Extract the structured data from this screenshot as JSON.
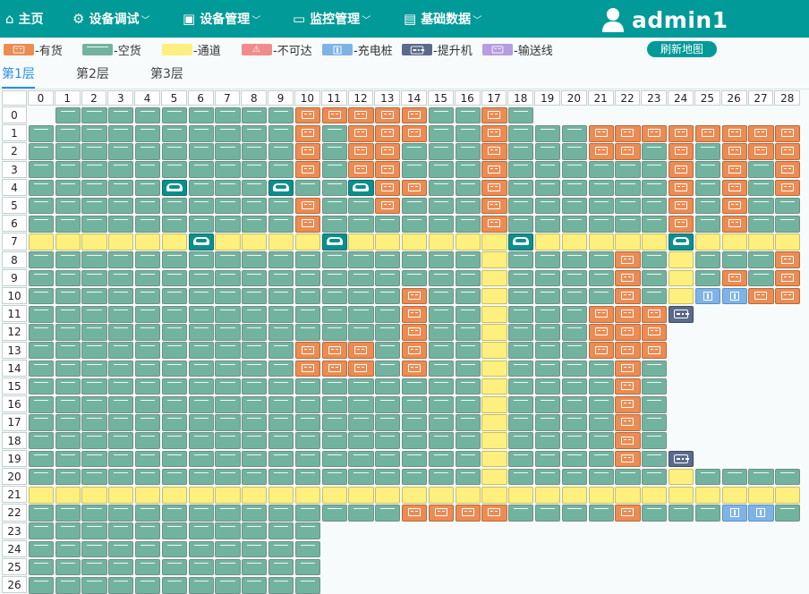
{
  "nav": {
    "items": [
      {
        "label": "主页",
        "icon": "home-icon",
        "dropdown": false
      },
      {
        "label": "设备调试",
        "icon": "gear-icon",
        "dropdown": true
      },
      {
        "label": "设备管理",
        "icon": "chip-icon",
        "dropdown": true
      },
      {
        "label": "监控管理",
        "icon": "camera-icon",
        "dropdown": true
      },
      {
        "label": "基础数据",
        "icon": "clipboard-icon",
        "dropdown": true
      }
    ],
    "user": {
      "name": "admin1",
      "icon": "user-icon"
    }
  },
  "legend": [
    {
      "key": "goods",
      "label": "-有货",
      "color": "#ec8b52"
    },
    {
      "key": "empty",
      "label": "-空货",
      "color": "#72b39f"
    },
    {
      "key": "aisle",
      "label": "-通道",
      "color": "#fdf07e"
    },
    {
      "key": "blocked",
      "label": "-不可达",
      "color": "#f28c8c"
    },
    {
      "key": "charge",
      "label": "-充电桩",
      "color": "#7fb3e6"
    },
    {
      "key": "lift",
      "label": "-提升机",
      "color": "#5b6a8a"
    },
    {
      "key": "conveyor",
      "label": "-输送线",
      "color": "#b69ce0"
    }
  ],
  "refresh_label": "刷新地图",
  "floor_tabs": [
    {
      "label": "第1层",
      "active": true
    },
    {
      "label": "第2层",
      "active": false
    },
    {
      "label": "第3层",
      "active": false
    }
  ],
  "grid": {
    "columns": [
      "0",
      "1",
      "2",
      "3",
      "4",
      "5",
      "6",
      "7",
      "8",
      "9",
      "10",
      "11",
      "12",
      "13",
      "14",
      "15",
      "16",
      "17",
      "18",
      "19",
      "20",
      "21",
      "22",
      "23",
      "24",
      "25",
      "26",
      "27",
      "28"
    ],
    "rows": [
      "0",
      "1",
      "2",
      "3",
      "4",
      "5",
      "6",
      "7",
      "8",
      "9",
      "10",
      "11",
      "12",
      "13",
      "14",
      "15",
      "16",
      "17",
      "18",
      "19",
      "20",
      "21",
      "22",
      "23",
      "24",
      "25",
      "26"
    ],
    "codes": {
      ".": "none",
      "E": "empty",
      "G": "goods",
      "Y": "aisle",
      "R": "robot",
      "C": "charge",
      "L": "lift"
    },
    "map": [
      ".EEEEEEEEEGGGGGEEGE..........",
      "EEEEEEEEEEGEGGGEEGEEEGGGGGGGG",
      "EEEEEEEEEEGEGGEEEGEEEGGEGEGGG",
      "EEEEEEEEEEGEGGEEEGEEEEEEGEGEG",
      "EEEEEREEEREERGGEEGEEEEEEGEGEG",
      "EEEEEEEEEEGEEGEEEGEEEEEEGEGEE",
      "EEEEEEEEEEGEEEEEEGEEEEEEGEGEE",
      "YYYYYYRYYYYRYYYYYYRYYYYYRYYYY",
      "EEEEEEEEEEEEEEEEEYEEEEGEYEEEG",
      "EEEEEEEEEEEEEEEEEYEEEEGEYEGEG",
      "EEEEEEEEEEEEEEGEEYEEEEGEYCCGG",
      "EEEEEEEEEEEEEEGEEYEEEGGGL....",
      "EEEEEEEEEEEEEEGEEYEEEGGG.....",
      "EEEEEEEEEEGGGEGEEYEEEGGG.....",
      "EEEEEEEEEEGGGEGEEYEEEEGE.....",
      "EEEEEEEEEEEEEEEEEYEEEEGE.....",
      "EEEEEEEEEEEEEEEEEYEEEEGE.....",
      "EEEEEEEEEEEEEEEEEYEEEEGE.....",
      "EEEEEEEEEEEEEEEEEYEEEEGE.....",
      "EEEEEEEEEEEEEEEEEYEEEEGEL....",
      "EEEEEEEEEEEEEEEEEYEEEEEEYEEEE",
      "YYYYYYYYYYYYYYYYYYYYYYYYYYYYY",
      "EEEEEEEEEEEEEEGGGGEEEEGEEECCE",
      "EEEEEEEEEEE..................",
      "EEEEEEEEEEE..................",
      "EEEEEEEEEEE..................",
      "EEEEEEEEEEE.................."
    ]
  }
}
